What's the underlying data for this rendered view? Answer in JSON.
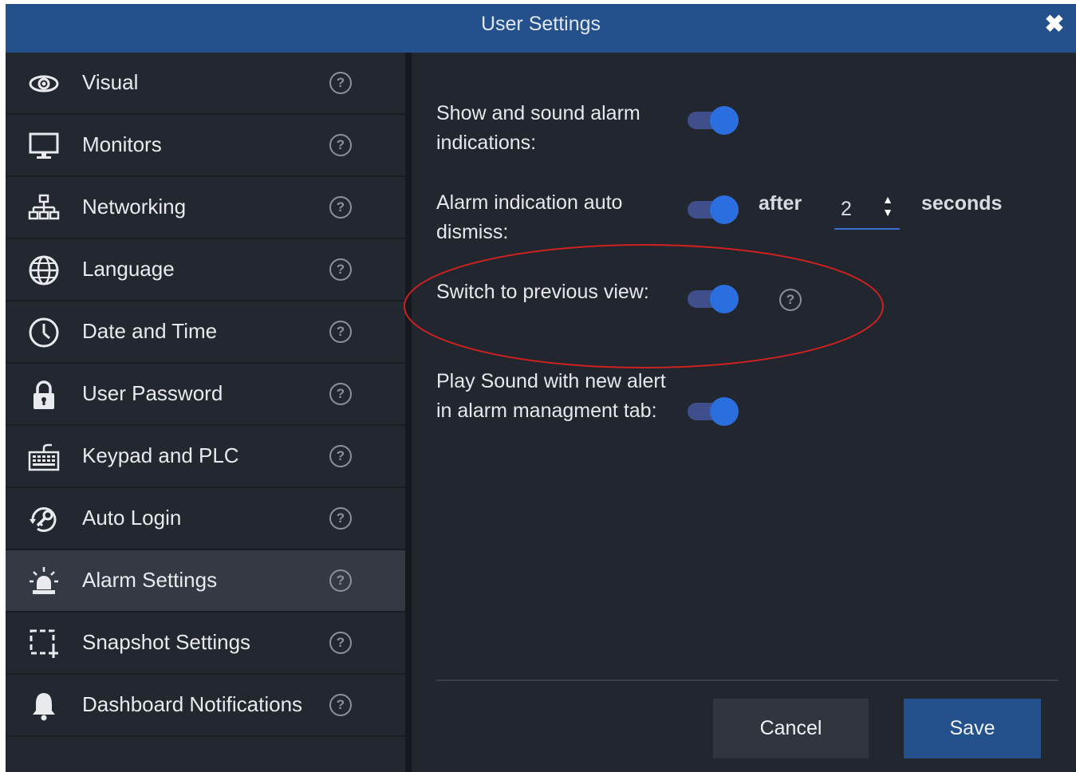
{
  "window": {
    "title": "User Settings",
    "close_glyph": "✖"
  },
  "sidebar": {
    "items": [
      {
        "label": "Visual",
        "icon": "eye-icon"
      },
      {
        "label": "Monitors",
        "icon": "monitor-icon"
      },
      {
        "label": "Networking",
        "icon": "network-icon"
      },
      {
        "label": "Language",
        "icon": "globe-icon"
      },
      {
        "label": "Date and Time",
        "icon": "clock-icon"
      },
      {
        "label": "User Password",
        "icon": "lock-icon"
      },
      {
        "label": "Keypad and PLC",
        "icon": "keypad-icon"
      },
      {
        "label": "Auto Login",
        "icon": "key-icon"
      },
      {
        "label": "Alarm Settings",
        "icon": "alarm-icon",
        "active": true
      },
      {
        "label": "Snapshot Settings",
        "icon": "snapshot-icon"
      },
      {
        "label": "Dashboard Notifications",
        "icon": "bell-icon"
      }
    ],
    "help_glyph": "?"
  },
  "settings": {
    "show_alarm": {
      "label": "Show and sound alarm indications:",
      "enabled": true
    },
    "auto_dismiss": {
      "label": "Alarm indication auto dismiss:",
      "enabled": true,
      "after_text": "after",
      "value": "2",
      "unit_text": "seconds"
    },
    "switch_previous": {
      "label": "Switch to previous view:",
      "enabled": true
    },
    "play_sound": {
      "label": "Play Sound with new alert in alarm managment tab:",
      "enabled": true
    }
  },
  "buttons": {
    "cancel": "Cancel",
    "save": "Save"
  },
  "colors": {
    "title_bar": "#24508b",
    "toggle_knob": "#2b6ee0",
    "highlight": "#cc2222"
  }
}
